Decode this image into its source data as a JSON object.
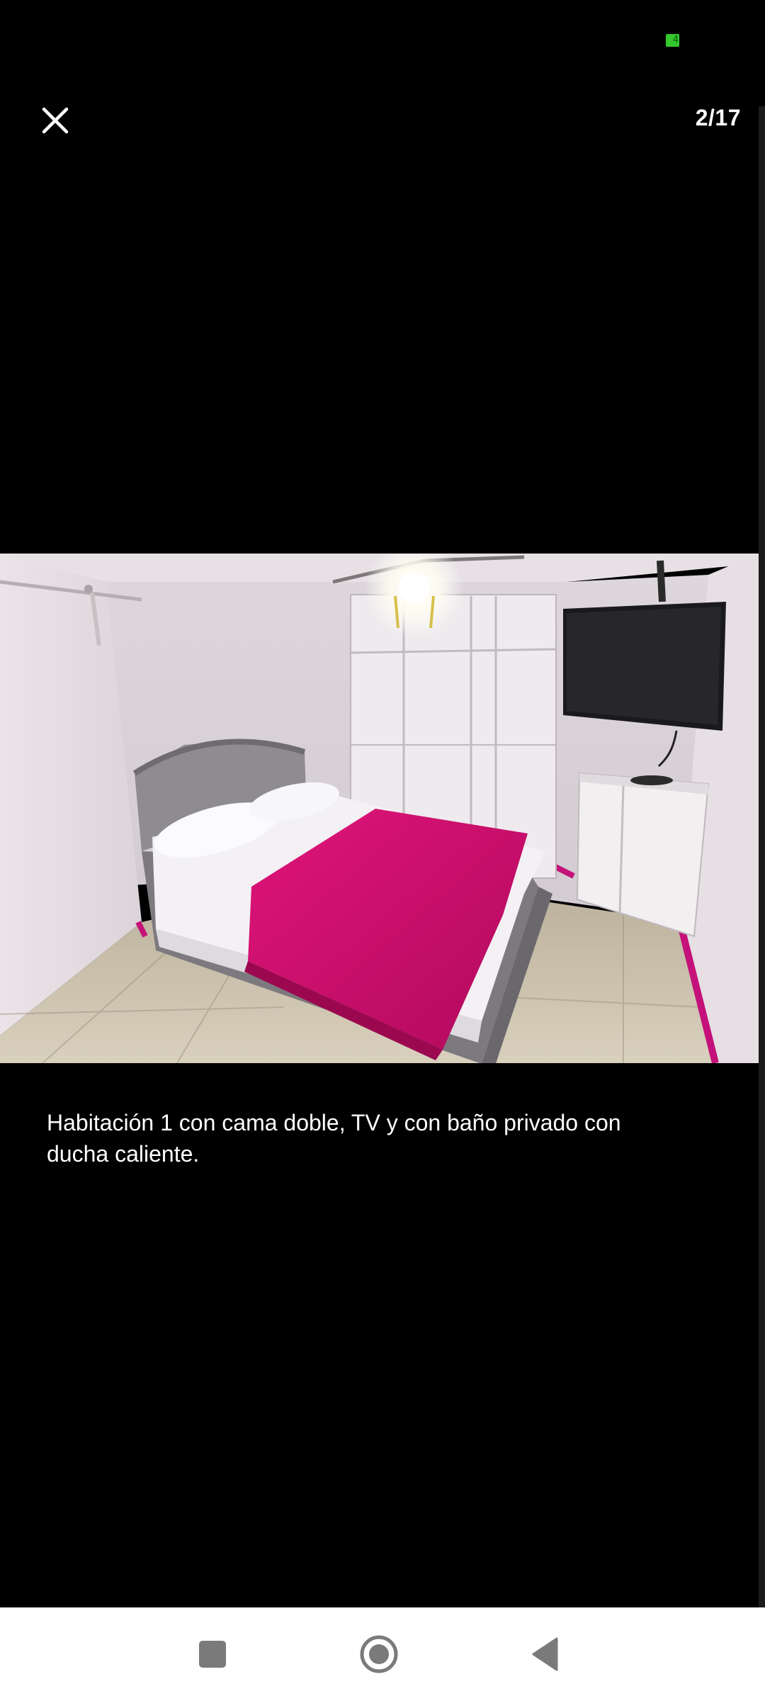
{
  "status_bar": {
    "battery_level": "4",
    "battery_color": "#33c92c"
  },
  "viewer": {
    "close_icon": "close-icon",
    "counter": "2/17",
    "caption": "Habitación 1 con cama doble, TV y con baño privado con ducha caliente."
  },
  "photo": {
    "description_icon": "bedroom-photo"
  },
  "nav_bar": {
    "recents_icon": "square-icon",
    "home_icon": "circle-icon",
    "back_icon": "triangle-back-icon"
  }
}
